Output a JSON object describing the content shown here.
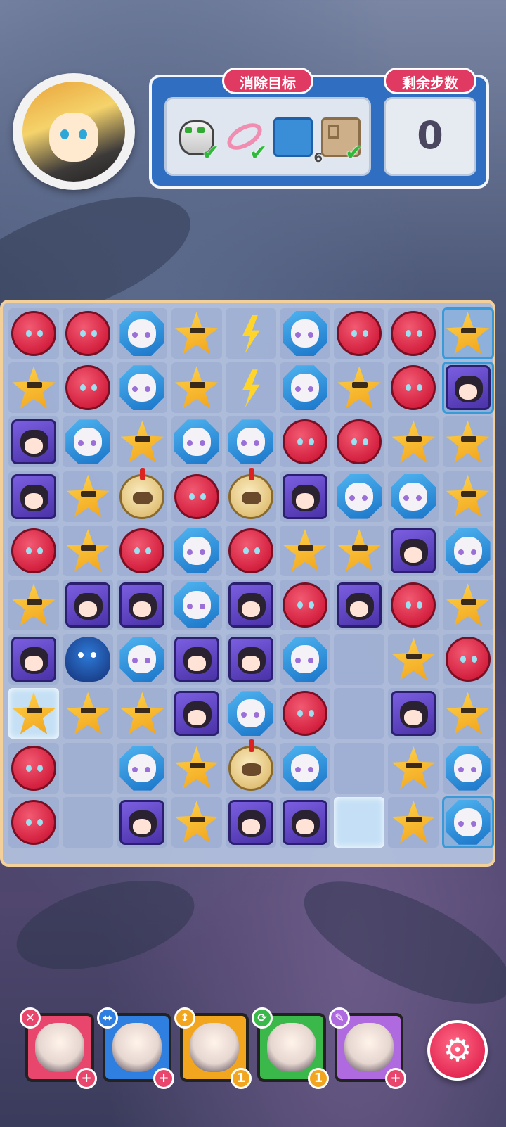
{
  "hud": {
    "goal_title": "消除目标",
    "moves_title": "剩余步数",
    "moves_left": "0",
    "targets": [
      {
        "icon": "robot-can-icon",
        "done": true
      },
      {
        "icon": "pink-ring-icon",
        "done": true
      },
      {
        "icon": "blue-tile-icon",
        "done": false,
        "remaining": "6"
      },
      {
        "icon": "stone-block-icon",
        "done": true
      }
    ]
  },
  "board": {
    "rows": 10,
    "cols": 9,
    "grid": [
      [
        "red",
        "red",
        "blue",
        "star",
        "bolt",
        "blue",
        "red",
        "red",
        "star"
      ],
      [
        "star",
        "red",
        "blue",
        "star",
        "bolt",
        "blue",
        "star",
        "red",
        "purple"
      ],
      [
        "purple",
        "blue",
        "star",
        "blue",
        "blue",
        "red",
        "red",
        "star",
        "star"
      ],
      [
        "purple",
        "star",
        "coin",
        "red",
        "coin",
        "purple",
        "blue",
        "blue",
        "star"
      ],
      [
        "red",
        "star",
        "red",
        "blue",
        "red",
        "star",
        "star",
        "purple",
        "blue"
      ],
      [
        "star",
        "purple",
        "purple",
        "blue",
        "purple",
        "red",
        "purple",
        "red",
        "star"
      ],
      [
        "purple",
        "crab",
        "blue",
        "purple",
        "purple",
        "blue",
        "",
        "star",
        "red"
      ],
      [
        "star",
        "star",
        "star",
        "purple",
        "blue",
        "red",
        "",
        "purple",
        "star"
      ],
      [
        "red",
        "",
        "blue",
        "star",
        "coin",
        "blue",
        "",
        "star",
        "blue"
      ],
      [
        "red",
        "",
        "purple",
        "star",
        "purple",
        "purple",
        "",
        "star",
        "blue"
      ]
    ],
    "ice_cells": [
      [
        7,
        0
      ],
      [
        9,
        6
      ]
    ],
    "framed_cells": [
      [
        0,
        8
      ],
      [
        1,
        8
      ],
      [
        9,
        8
      ]
    ]
  },
  "characters": [
    {
      "name": "character-card-1",
      "skill_icon": "✕",
      "badge": "+",
      "color": "#e8466c"
    },
    {
      "name": "character-card-2",
      "skill_icon": "↔",
      "badge": "+",
      "color": "#2f7fe0"
    },
    {
      "name": "character-card-3",
      "skill_icon": "↕",
      "badge": "1",
      "color": "#f2a51e"
    },
    {
      "name": "character-card-4",
      "skill_icon": "⟳",
      "badge": "1",
      "color": "#3bb84a"
    },
    {
      "name": "character-card-5",
      "skill_icon": "✎",
      "badge": "+",
      "color": "#b06ae0"
    }
  ],
  "settings_icon": "⚙"
}
